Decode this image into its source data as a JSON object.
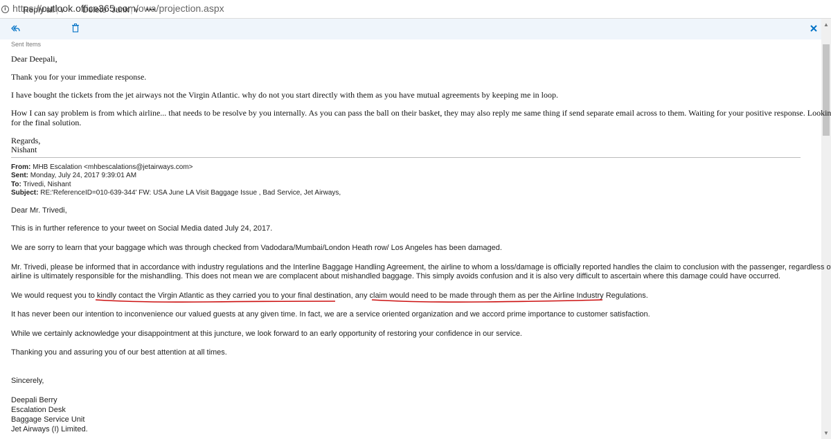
{
  "address_bar": {
    "url_scheme": "https://",
    "url_host": "outlook.office365.com",
    "url_path": "/owa/projection.aspx"
  },
  "toolbar": {
    "reply_all_label": "Reply all",
    "delete_label": "Delete",
    "junk_label": "Junk",
    "more_label": "•••",
    "reply_icon": "reply-all-icon",
    "delete_icon": "trash-icon",
    "close_icon": "close-icon"
  },
  "folder_label": "Sent Items",
  "reply": {
    "greeting": "Dear Deepali,",
    "paragraphs": [
      "Thank you for your immediate response.",
      "I have bought the tickets from the jet airways not the Virgin Atlantic. why do not you start directly with them as you have mutual agreements by keeping me in loop.",
      "How I can say problem is from which airline... that needs to be resolve by you internally.  As you can pass the ball on their basket, they may also reply me same thing if send separate email across to them. Waiting for your positive response. Looking forward",
      "for the final solution."
    ],
    "closing": "Regards,",
    "signature": "Nishant"
  },
  "original_header": {
    "from_label": "From:",
    "from_value": "MHB Escalation <mhbescalations@jetairways.com>",
    "sent_label": "Sent:",
    "sent_value": "Monday, July 24, 2017 9:39:01 AM",
    "to_label": "To:",
    "to_value": "Trivedi, Nishant",
    "subject_label": "Subject:",
    "subject_value": "RE:'ReferenceID=010-639-344' FW: USA June LA Visit Baggage Issue , Bad Service, Jet Airways,"
  },
  "original_body": {
    "greeting": "Dear Mr. Trivedi,",
    "p1": "This is in further reference to your tweet on Social Media dated July 24, 2017.",
    "p2": "We are sorry to learn that your baggage which was through checked from Vadodara/Mumbai/London Heath row/ Los Angeles has been damaged.",
    "p3_line1": "Mr. Trivedi, please be informed that in accordance with industry regulations and the Interline Baggage Handling Agreement, the airline to whom a loss/damage is officially reported handles the claim to conclusion with the passenger, regardless of which",
    "p3_line2": "airline is ultimately responsible for the mishandling.  This does not mean we are complacent about mishandled baggage.  This simply avoids confusion and it is also very difficult to ascertain where this damage could have occurred.",
    "p4": "We would request you to kindly contact the Virgin Atlantic as they carried you to your final destination, any claim would need to be made through them as per the Airline Industry Regulations.",
    "p5": "It has never been our intention to inconvenience our valued guests at any given time. In fact, we are a service oriented organization and we accord prime importance to customer satisfaction.",
    "p6": "While we certainly acknowledge your disappointment at this juncture, we look forward to an early opportunity of restoring your confidence in our service.",
    "p7": "Thanking you and assuring you of our best attention at all times.",
    "closing": "Sincerely,",
    "sig1": "Deepali Berry",
    "sig2": "Escalation  Desk",
    "sig3": "Baggage Service Unit",
    "sig4": "Jet Airways (I) Limited."
  },
  "colors": {
    "toolbar_bg": "#eff5fb",
    "accent": "#0072c6",
    "annotation_red": "#cc1111"
  }
}
